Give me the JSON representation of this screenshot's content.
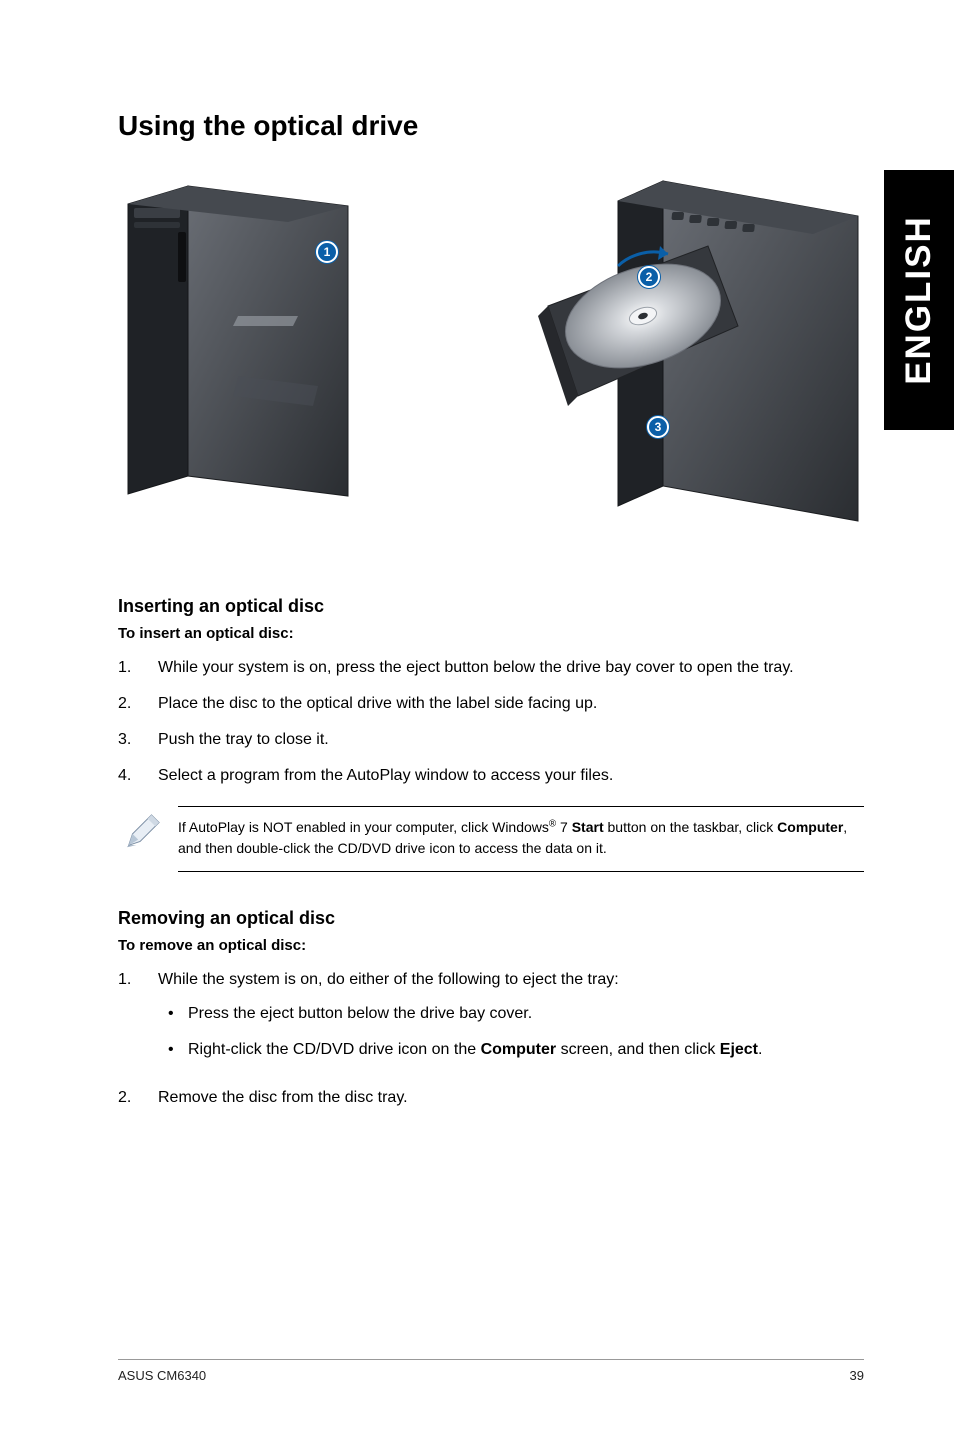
{
  "side_tab": "ENGLISH",
  "title": "Using the optical drive",
  "callouts": {
    "c1": "1",
    "c2": "2",
    "c3": "3"
  },
  "insert": {
    "heading": "Inserting an optical disc",
    "lead": "To insert an optical disc:",
    "steps": [
      {
        "n": "1.",
        "t": "While your system is on, press the eject button below the drive bay cover to open the tray."
      },
      {
        "n": "2.",
        "t": "Place the disc to the optical drive with the label side facing up."
      },
      {
        "n": "3.",
        "t": "Push the tray to close it."
      },
      {
        "n": "4.",
        "t": "Select a program from the AutoPlay window to access your files."
      }
    ]
  },
  "note": {
    "pre": "If AutoPlay is NOT enabled in your computer, click Windows",
    "sup": "®",
    "mid": " 7 ",
    "start_bold": "Start",
    "mid2": " button on the taskbar, click ",
    "computer_bold": "Computer",
    "post": ", and then double-click the CD/DVD drive icon to access the data on it."
  },
  "remove": {
    "heading": "Removing an optical disc",
    "lead": "To remove an optical disc:",
    "step1_n": "1.",
    "step1_t": "While the system is on, do either of the following to eject the tray:",
    "bullet1": "Press the eject button below the drive bay cover.",
    "bullet2_pre": "Right-click the CD/DVD drive icon on the ",
    "bullet2_b1": "Computer",
    "bullet2_mid": " screen, and then click ",
    "bullet2_b2": "Eject",
    "bullet2_post": ".",
    "step2_n": "2.",
    "step2_t": "Remove the disc from the disc tray."
  },
  "footer": {
    "left": "ASUS CM6340",
    "right": "39"
  }
}
